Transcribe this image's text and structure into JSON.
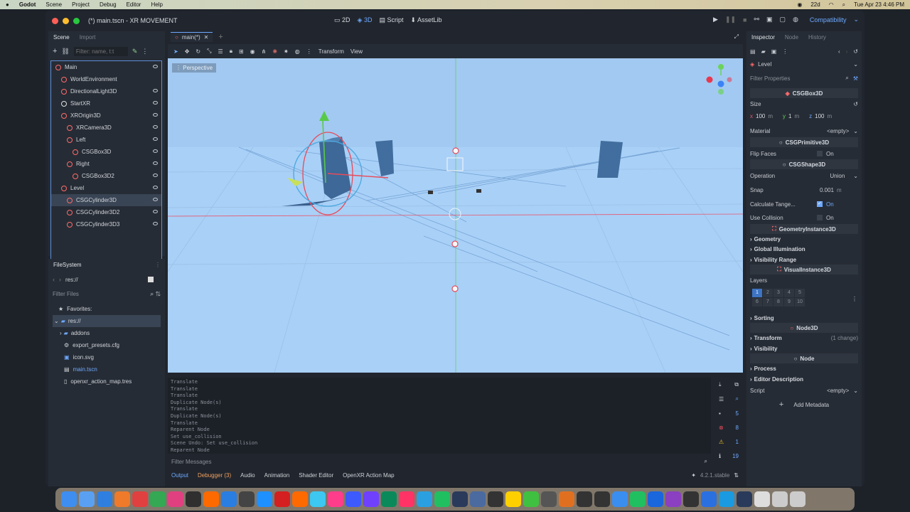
{
  "menubar": {
    "apple": "",
    "app": "Godot",
    "items": [
      "Scene",
      "Project",
      "Debug",
      "Editor",
      "Help"
    ],
    "battery": "22d",
    "clock": "Tue Apr 23 4:46 PM"
  },
  "window": {
    "title": "(*) main.tscn - XR MOVEMENT",
    "modes": [
      "2D",
      "3D",
      "Script",
      "AssetLib"
    ],
    "renderer": "Compatibility"
  },
  "scene_dock": {
    "tabs": [
      "Scene",
      "Import"
    ],
    "filter_placeholder": "Filter: name, t:t",
    "nodes": [
      {
        "label": "Main",
        "indent": 0,
        "color": "#ff6b6b",
        "eye": true
      },
      {
        "label": "WorldEnvironment",
        "indent": 1,
        "color": "#ff6b6b",
        "eye": false
      },
      {
        "label": "DirectionalLight3D",
        "indent": 1,
        "color": "#ff6b6b",
        "eye": true
      },
      {
        "label": "StartXR",
        "indent": 1,
        "color": "#e0e0e0",
        "eye": true
      },
      {
        "label": "XROrigin3D",
        "indent": 1,
        "color": "#ff6b6b",
        "eye": true
      },
      {
        "label": "XRCamera3D",
        "indent": 2,
        "color": "#ff6b6b",
        "eye": true
      },
      {
        "label": "Left",
        "indent": 2,
        "color": "#ff6b6b",
        "eye": true
      },
      {
        "label": "CSGBox3D",
        "indent": 3,
        "color": "#ff6b6b",
        "eye": true
      },
      {
        "label": "Right",
        "indent": 2,
        "color": "#ff6b6b",
        "eye": true
      },
      {
        "label": "CSGBox3D2",
        "indent": 3,
        "color": "#ff6b6b",
        "eye": true
      },
      {
        "label": "Level",
        "indent": 1,
        "color": "#ff6b6b",
        "eye": true
      },
      {
        "label": "CSGCylinder3D",
        "indent": 2,
        "color": "#ff6b6b",
        "eye": true,
        "selected": true
      },
      {
        "label": "CSGCylinder3D2",
        "indent": 2,
        "color": "#ff6b6b",
        "eye": true
      },
      {
        "label": "CSGCylinder3D3",
        "indent": 2,
        "color": "#ff6b6b",
        "eye": true
      }
    ]
  },
  "filesystem": {
    "title": "FileSystem",
    "path": "res://",
    "filter_placeholder": "Filter Files",
    "items": [
      "Favorites:",
      "res://",
      "addons",
      "export_presets.cfg",
      "icon.svg",
      "main.tscn",
      "openxr_action_map.tres"
    ]
  },
  "editor_tabs": {
    "active": "main(*)"
  },
  "viewport": {
    "toolbar": [
      "Transform",
      "View"
    ],
    "perspective_label": "Perspective"
  },
  "output": {
    "lines": [
      "Translate",
      "Translate",
      "Translate",
      "Duplicate Node(s)",
      "Translate",
      "Duplicate Node(s)",
      "Translate",
      "Reparent Node",
      "Set use_collision",
      "Scene Undo: Set use_collision",
      "Reparent Node"
    ],
    "filter_placeholder": "Filter Messages",
    "counts": {
      "messages": "5",
      "errors": "8",
      "warnings": "1",
      "info": "19"
    }
  },
  "bottom_tabs": [
    "Output",
    "Debugger (3)",
    "Audio",
    "Animation",
    "Shader Editor",
    "OpenXR Action Map"
  ],
  "version": "4.2.1.stable",
  "inspector": {
    "tabs": [
      "Inspector",
      "Node",
      "History"
    ],
    "object": "Level",
    "filter_placeholder": "Filter Properties",
    "csgbox": "CSGBox3D",
    "size_label": "Size",
    "size": {
      "x": "100",
      "y": "1",
      "z": "100",
      "unit": "m"
    },
    "material_label": "Material",
    "material_value": "<empty>",
    "csgprimitive": "CSGPrimitive3D",
    "flip_faces": "Flip Faces",
    "on": "On",
    "csgshape": "CSGShape3D",
    "operation_label": "Operation",
    "operation_value": "Union",
    "snap_label": "Snap",
    "snap_value": "0.001",
    "snap_unit": "m",
    "calc_tangents": "Calculate Tange...",
    "use_collision": "Use Collision",
    "geom_instance": "GeometryInstance3D",
    "geometry": "Geometry",
    "global_illum": "Global Illumination",
    "visibility_range": "Visibility Range",
    "visual_instance": "VisualInstance3D",
    "layers_label": "Layers",
    "layers": [
      "1",
      "2",
      "3",
      "4",
      "5",
      "6",
      "7",
      "8",
      "9",
      "10"
    ],
    "sorting": "Sorting",
    "node3d": "Node3D",
    "transform": "Transform",
    "transform_change": "(1 change)",
    "visibility": "Visibility",
    "node": "Node",
    "process": "Process",
    "editor_desc": "Editor Description",
    "script_label": "Script",
    "script_value": "<empty>",
    "add_metadata": "Add Metadata"
  }
}
